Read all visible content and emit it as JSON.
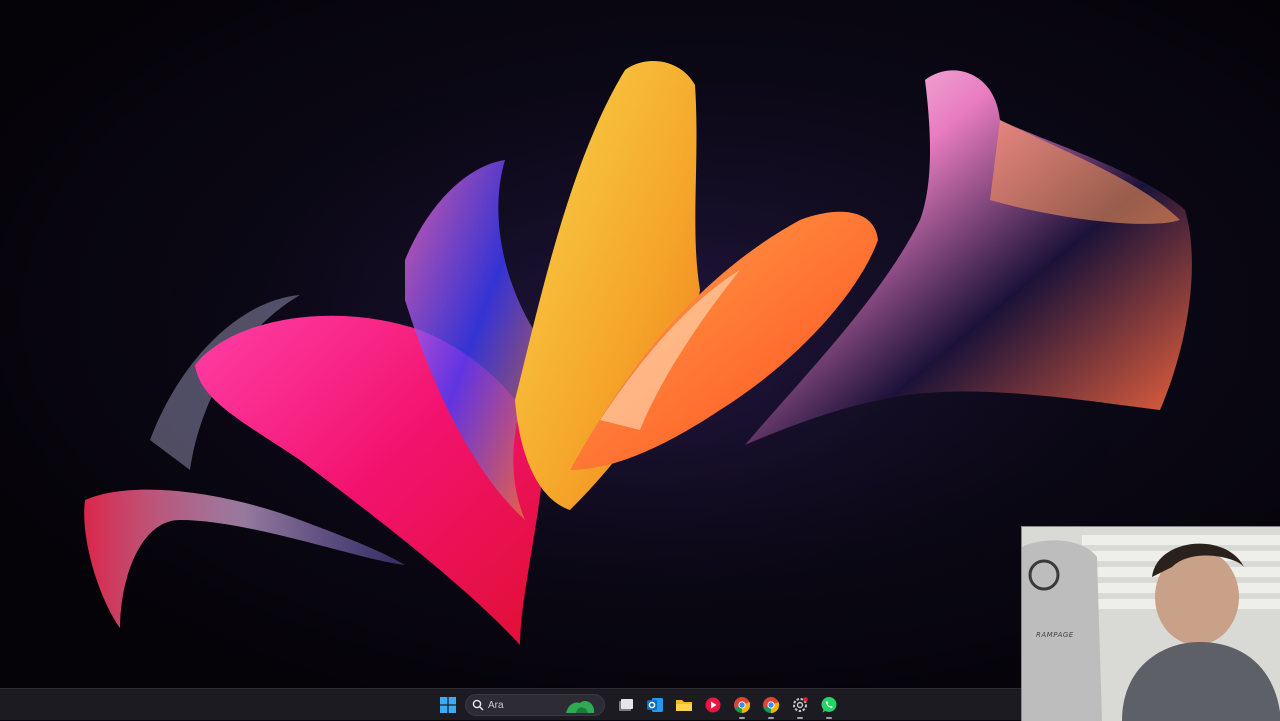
{
  "taskbar": {
    "search": {
      "placeholder": "Ara"
    },
    "apps": [
      {
        "name": "start",
        "icon": "windows-logo-icon"
      },
      {
        "name": "task-view",
        "icon": "task-view-icon"
      },
      {
        "name": "outlook",
        "icon": "outlook-icon"
      },
      {
        "name": "file-explorer",
        "icon": "folder-icon"
      },
      {
        "name": "media-player",
        "icon": "media-player-icon"
      },
      {
        "name": "chrome",
        "icon": "chrome-icon"
      },
      {
        "name": "chrome-profile-2",
        "icon": "chrome-icon"
      },
      {
        "name": "app-gear",
        "icon": "gear-icon"
      },
      {
        "name": "whatsapp",
        "icon": "whatsapp-icon"
      }
    ]
  },
  "webcam": {
    "chair_brand": "RAMPAGE"
  },
  "colors": {
    "taskbar_bg": "#1c1b22",
    "wallpaper_bg": "#07050d",
    "accent_blue": "#2f8cff"
  }
}
